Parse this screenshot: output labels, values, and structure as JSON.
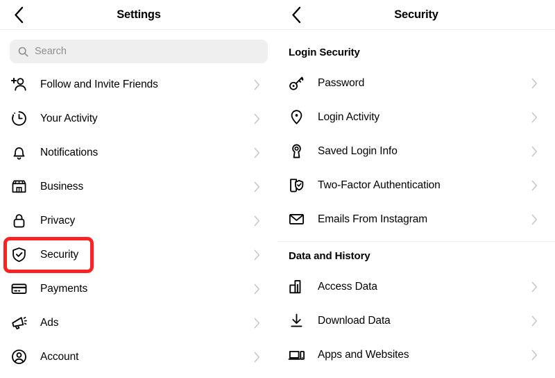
{
  "app": "instagram-settings",
  "colors": {
    "accent_highlight": "#fb2222",
    "divider": "#efefef",
    "search_bg": "#efefef",
    "placeholder_text": "#8e8e8e",
    "text": "#000000",
    "chevron": "#c7c7c7"
  },
  "left_panel": {
    "header": {
      "title": "Settings",
      "back_icon": "chevron-left-icon"
    },
    "search": {
      "placeholder": "Search",
      "value": "",
      "icon": "search-icon"
    },
    "items": [
      {
        "label": "Follow and Invite Friends",
        "icon": "add-person-icon",
        "chevron": "chevron-right-icon",
        "highlighted": false
      },
      {
        "label": "Your Activity",
        "icon": "clock-activity-icon",
        "chevron": "chevron-right-icon",
        "highlighted": false
      },
      {
        "label": "Notifications",
        "icon": "bell-icon",
        "chevron": "chevron-right-icon",
        "highlighted": false
      },
      {
        "label": "Business",
        "icon": "storefront-icon",
        "chevron": "chevron-right-icon",
        "highlighted": false
      },
      {
        "label": "Privacy",
        "icon": "lock-icon",
        "chevron": "chevron-right-icon",
        "highlighted": false
      },
      {
        "label": "Security",
        "icon": "shield-check-icon",
        "chevron": "chevron-right-icon",
        "highlighted": true
      },
      {
        "label": "Payments",
        "icon": "credit-card-icon",
        "chevron": "chevron-right-icon",
        "highlighted": false
      },
      {
        "label": "Ads",
        "icon": "megaphone-icon",
        "chevron": "chevron-right-icon",
        "highlighted": false
      },
      {
        "label": "Account",
        "icon": "account-circle-icon",
        "chevron": "chevron-right-icon",
        "highlighted": false
      }
    ]
  },
  "right_panel": {
    "header": {
      "title": "Security",
      "back_icon": "chevron-left-icon"
    },
    "sections": [
      {
        "title": "Login Security",
        "items": [
          {
            "label": "Password",
            "icon": "key-icon",
            "chevron": "chevron-right-icon",
            "highlighted": false
          },
          {
            "label": "Login Activity",
            "icon": "location-pin-icon",
            "chevron": "chevron-right-icon",
            "highlighted": false
          },
          {
            "label": "Saved Login Info",
            "icon": "padlock-keyhole-icon",
            "chevron": "chevron-right-icon",
            "highlighted": false
          },
          {
            "label": "Two-Factor Authentication",
            "icon": "phone-shield-check-icon",
            "chevron": "chevron-right-icon",
            "highlighted": false
          },
          {
            "label": "Emails From Instagram",
            "icon": "envelope-icon",
            "chevron": "chevron-right-icon",
            "highlighted": false
          }
        ]
      },
      {
        "title": "Data and History",
        "items": [
          {
            "label": "Access Data",
            "icon": "bar-chart-icon",
            "chevron": "chevron-right-icon",
            "highlighted": false
          },
          {
            "label": "Download Data",
            "icon": "download-arrow-icon",
            "chevron": "chevron-right-icon",
            "highlighted": false
          },
          {
            "label": "Apps and Websites",
            "icon": "devices-icon",
            "chevron": "chevron-right-icon",
            "highlighted": true
          }
        ]
      }
    ]
  }
}
